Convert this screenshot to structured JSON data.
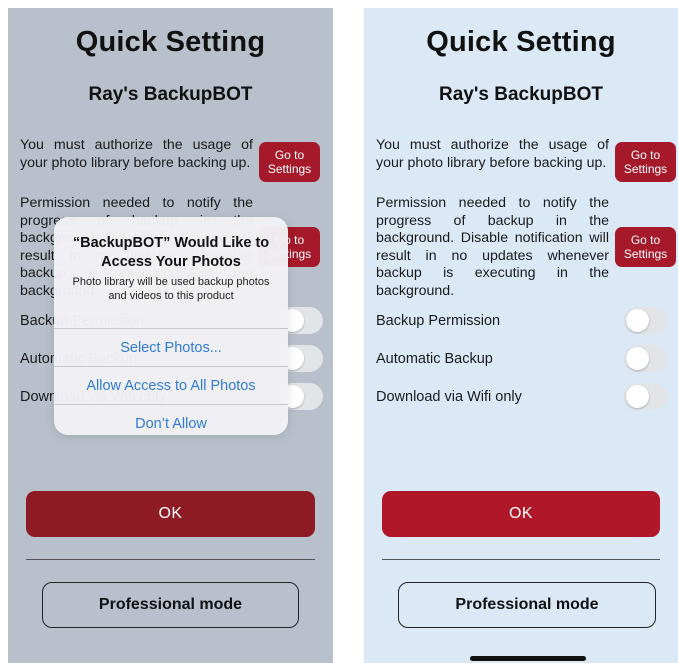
{
  "title": "Quick Setting",
  "subtitle": "Ray's BackupBOT",
  "photo_permission_text": "You must authorize the usage of your photo library before backing up.",
  "notify_permission_text": "Permission needed to notify the progress of backup in the background. Disable notification will result in no updates whenever backup is executing in the background.",
  "go_to_settings_label": "Go to Settings",
  "toggles": [
    {
      "label": "Backup Permission",
      "on": false
    },
    {
      "label": "Automatic Backup",
      "on": false
    },
    {
      "label": "Download via Wifi only",
      "on": false
    }
  ],
  "ok_label": "OK",
  "pro_mode_label": "Professional mode",
  "alert": {
    "title": "“BackupBOT” Would Like to Access Your Photos",
    "message": "Photo library will be used backup photos and videos to this product",
    "actions": [
      "Select Photos...",
      "Allow Access to All Photos",
      "Don’t Allow"
    ],
    "action_color": "#2f7bd9"
  },
  "colors": {
    "left_background": "#b8c0cc",
    "right_background": "#dbe9f7",
    "accent_red": "#a5192a"
  }
}
